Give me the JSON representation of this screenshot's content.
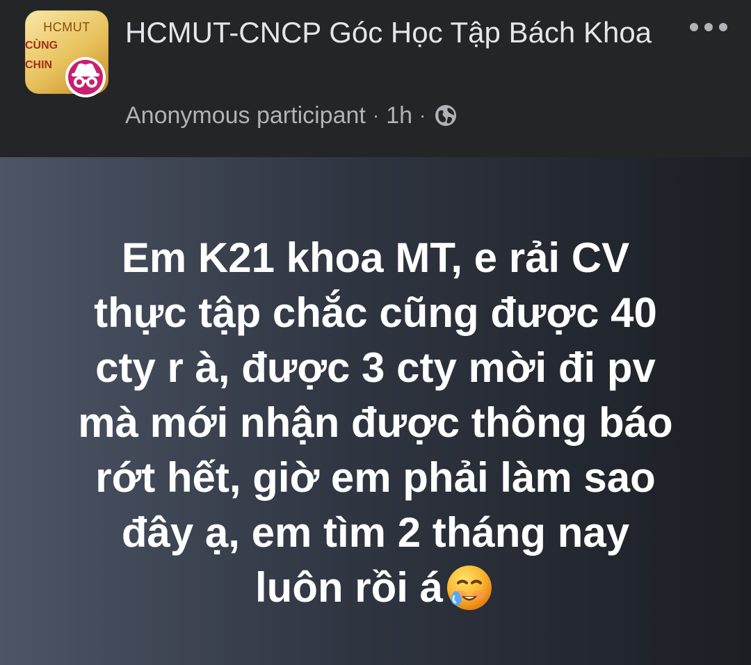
{
  "group": {
    "name": "HCMUT-CNCP Góc Học Tập Bách Khoa",
    "avatar_text": "HCMUT",
    "avatar_art_line_1": "CÙNG",
    "avatar_art_line_2": "CHIN"
  },
  "author": {
    "label": "Anonymous participant",
    "time": "1h",
    "separator": "·",
    "privacy_icon": "globe-icon",
    "anonymous_icon": "incognito-icon"
  },
  "actions": {
    "more_icon": "more-options-icon"
  },
  "post": {
    "lines": [
      "Em K21 khoa MT, e rải CV",
      "thực tập chắc cũng được 40",
      "cty r à, được 3 cty mời đi pv",
      "mà mới nhận được thông báo",
      "rớt hết, giờ em phải làm sao",
      "đây ạ, em tìm 2 tháng nay",
      "luôn rồi á"
    ],
    "emoji": "crying-face-emoji"
  },
  "colors": {
    "header_bg": "#242526",
    "primary_text": "#e4e6eb",
    "secondary_text": "#b0b3b8",
    "post_text": "#ffffff",
    "badge_pink": "#c6206f",
    "post_gradient_left": "#4d5566",
    "post_gradient_right": "#1b1e23"
  }
}
